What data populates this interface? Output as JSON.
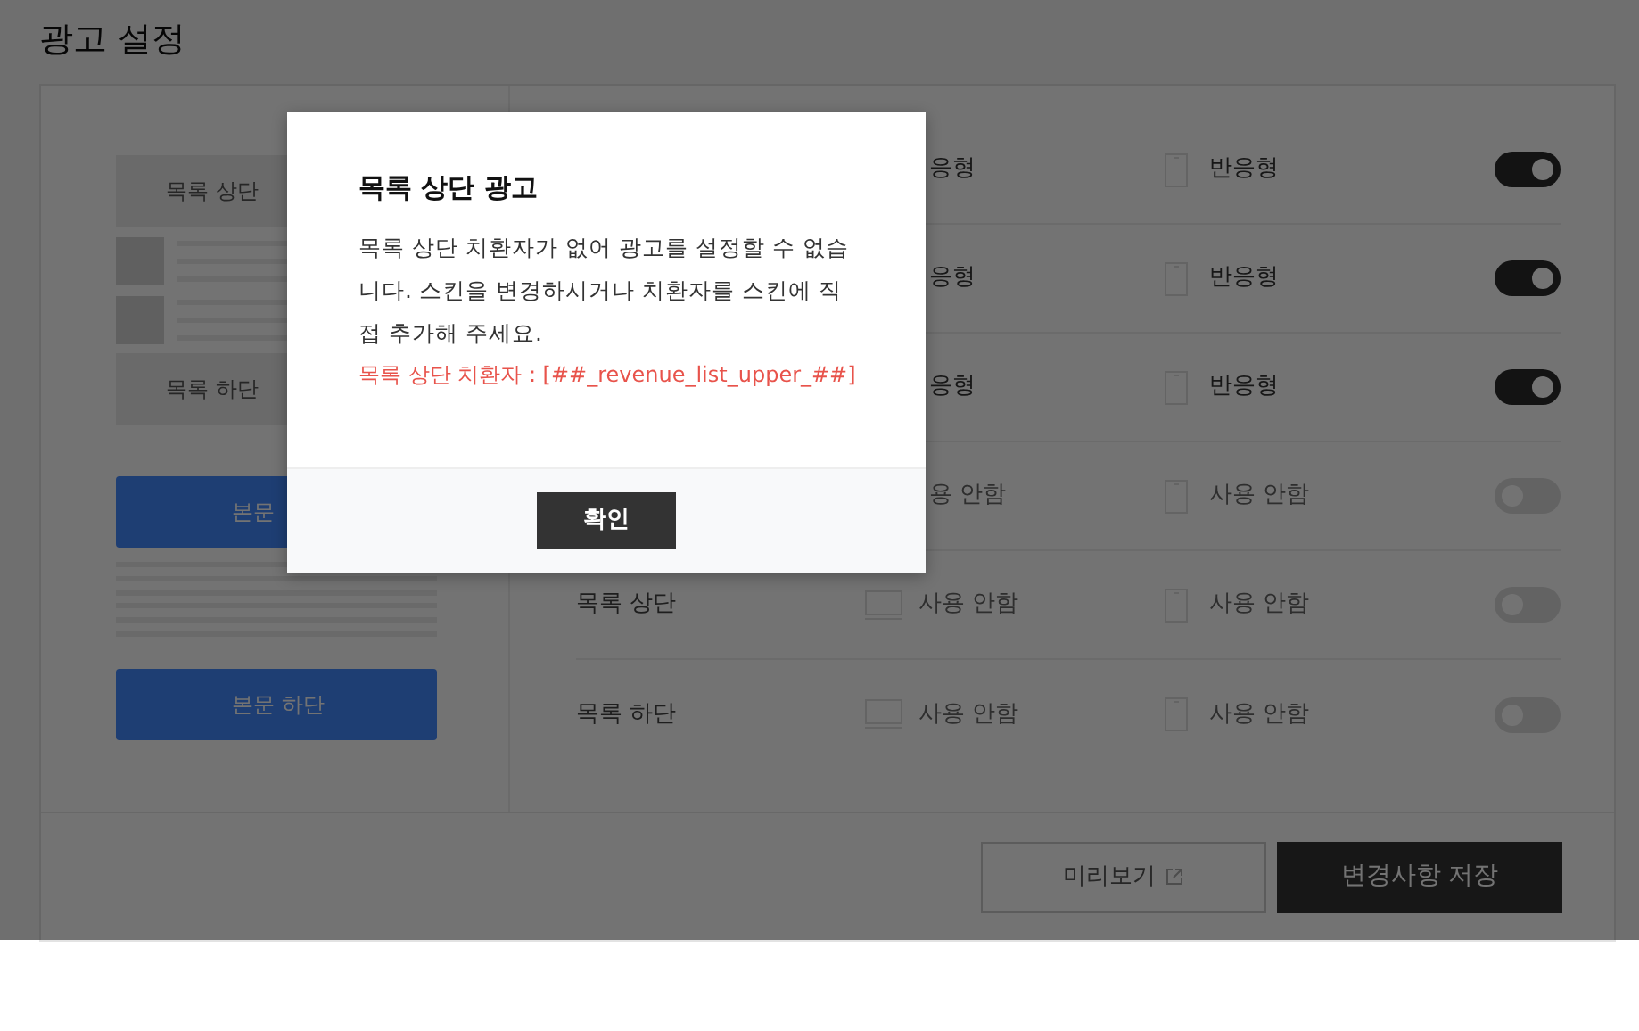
{
  "page_title": "광고 설정",
  "preview_blocks": [
    {
      "kind": "slot",
      "label": "목록 상단"
    },
    {
      "kind": "list"
    },
    {
      "kind": "slot",
      "label": "목록 하단"
    },
    {
      "kind": "button",
      "label": "본문"
    },
    {
      "kind": "lines"
    },
    {
      "kind": "button",
      "label": "본문 하단"
    }
  ],
  "rows": [
    {
      "pc": "응형",
      "mobile": "반응형",
      "on": true
    },
    {
      "pc": "응형",
      "mobile": "반응형",
      "on": true
    },
    {
      "pc": "응형",
      "mobile": "반응형",
      "on": true
    },
    {
      "pc": "용 안함",
      "mobile": "사용 안함",
      "on": false
    },
    {
      "name": "목록 상단",
      "pc": "사용 안함",
      "mobile": "사용 안함",
      "on": false
    },
    {
      "name": "목록 하단",
      "pc": "사용 안함",
      "mobile": "사용 안함",
      "on": false
    }
  ],
  "footer": {
    "preview_button": "미리보기",
    "save_button": "변경사항 저장"
  },
  "dialog": {
    "title": "목록 상단 광고",
    "message": "목록 상단 치환자가 없어 광고를 설정할 수 없습니다. 스킨을 변경하시거나 치환자를 스킨에 직접 추가해 주세요.",
    "code_line": "목록 상단 치환자 : [##_revenue_list_upper_##]",
    "confirm_button": "확인"
  }
}
